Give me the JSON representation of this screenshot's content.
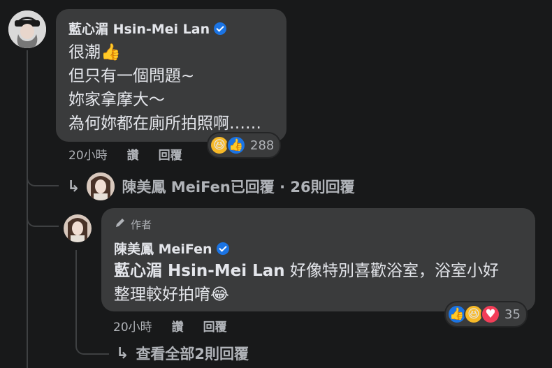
{
  "colors": {
    "like_blue": "#1b74e4",
    "haha_yellow": "#f7b928",
    "love_red": "#f33e58",
    "text": "#e4e6eb",
    "muted": "#b0b3b8"
  },
  "comment1": {
    "author": "藍心湄 Hsin-Mei Lan",
    "lines": [
      "很潮👍",
      "但只有一個問題~",
      "妳家拿摩大～",
      "為何妳都在廁所拍照啊……"
    ],
    "time": "20小時",
    "like_label": "讚",
    "reply_label": "回覆",
    "reaction_icons": [
      "haha-icon",
      "like-icon"
    ],
    "reaction_count": "288"
  },
  "reply_summary": {
    "arrow_icon": "reply-arrow-icon",
    "text": "陳美鳳 MeiFen已回覆 · 26則回覆"
  },
  "comment2": {
    "badge_icon": "pen-icon",
    "badge_label": "作者",
    "author": "陳美鳳 MeiFen",
    "mention": "藍心湄 Hsin-Mei Lan",
    "text_line1": " 好像特別喜歡浴室，浴室小好",
    "text_line2": "整理較好拍唷😂",
    "time": "20小時",
    "like_label": "讚",
    "reply_label": "回覆",
    "reaction_icons": [
      "like-icon",
      "haha-icon",
      "love-icon"
    ],
    "reaction_count": "35"
  },
  "view_all": {
    "arrow_icon": "reply-arrow-icon",
    "text": "查看全部2則回覆"
  }
}
